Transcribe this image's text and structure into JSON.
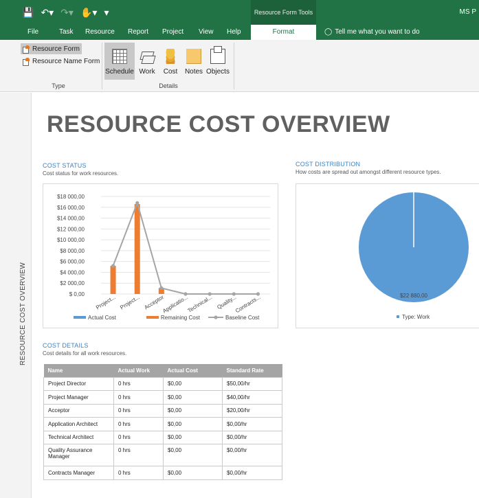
{
  "titlebar": {
    "qat_icons": [
      "save-icon",
      "undo-icon",
      "redo-icon",
      "touch-mode-icon",
      "customize-icon"
    ],
    "tool_context": "Resource Form Tools",
    "user": "MS P"
  },
  "ribbon": {
    "tabs": [
      "File",
      "Task",
      "Resource",
      "Report",
      "Project",
      "View",
      "Help"
    ],
    "active_tab": "Format",
    "tell_me": "Tell me what you want to do",
    "type_group": {
      "label": "Type",
      "items": [
        "Resource Form",
        "Resource Name Form"
      ]
    },
    "details_group": {
      "label": "Details",
      "buttons": [
        "Schedule",
        "Work",
        "Cost",
        "Notes",
        "Objects"
      ]
    }
  },
  "side_label": "RESOURCE COST OVERVIEW",
  "report": {
    "title": "RESOURCE COST OVERVIEW",
    "cost_status": {
      "title": "COST STATUS",
      "subtitle": "Cost status for work resources."
    },
    "cost_distribution": {
      "title": "COST DISTRIBUTION",
      "subtitle": "How costs are spread out amongst different resource types."
    },
    "cost_details": {
      "title": "COST DETAILS",
      "subtitle": "Cost details for all work resources.",
      "columns": [
        "Name",
        "Actual Work",
        "Actual Cost",
        "Standard Rate"
      ],
      "rows": [
        [
          "Project Director",
          "0 hrs",
          "$0,00",
          "$50,00/hr"
        ],
        [
          "Project Manager",
          "0 hrs",
          "$0,00",
          "$40,00/hr"
        ],
        [
          "Acceptor",
          "0 hrs",
          "$0,00",
          "$20,00/hr"
        ],
        [
          "Application Architect",
          "0 hrs",
          "$0,00",
          "$0,00/hr"
        ],
        [
          "Technical Architect",
          "0 hrs",
          "$0,00",
          "$0,00/hr"
        ],
        [
          "Quality Assurance Manager",
          "0 hrs",
          "$0,00",
          "$0,00/hr"
        ],
        [
          "Contracts Manager",
          "0 hrs",
          "$0,00",
          "$0,00/hr"
        ]
      ]
    }
  },
  "chart_data": [
    {
      "type": "bar",
      "categories": [
        "Project...",
        "Project...",
        "Acceptor",
        "Applicatio...",
        "Technical...",
        "Quality...",
        "Contracts..."
      ],
      "series": [
        {
          "name": "Actual Cost",
          "kind": "bar",
          "color": "#5b9bd5",
          "values": [
            0,
            0,
            0,
            0,
            0,
            0,
            0
          ]
        },
        {
          "name": "Remaining Cost",
          "kind": "bar",
          "color": "#ed7d31",
          "values": [
            5200,
            16600,
            1100,
            0,
            0,
            0,
            0
          ]
        },
        {
          "name": "Baseline Cost",
          "kind": "line",
          "color": "#a5a5a5",
          "values": [
            5200,
            16800,
            1100,
            0,
            0,
            0,
            0
          ]
        }
      ],
      "yticks": [
        "$18 000,00",
        "$16 000,00",
        "$14 000,00",
        "$12 000,00",
        "$10 000,00",
        "$8 000,00",
        "$6 000,00",
        "$4 000,00",
        "$2 000,00",
        "$ 0,00"
      ],
      "ylim": [
        0,
        18000
      ],
      "legend": "bottom",
      "grid": true
    },
    {
      "type": "pie",
      "slices": [
        {
          "name": "Type: Work",
          "value": 22880,
          "label": "$22 880,00",
          "color": "#5b9bd5"
        }
      ],
      "legend": "bottom"
    }
  ]
}
